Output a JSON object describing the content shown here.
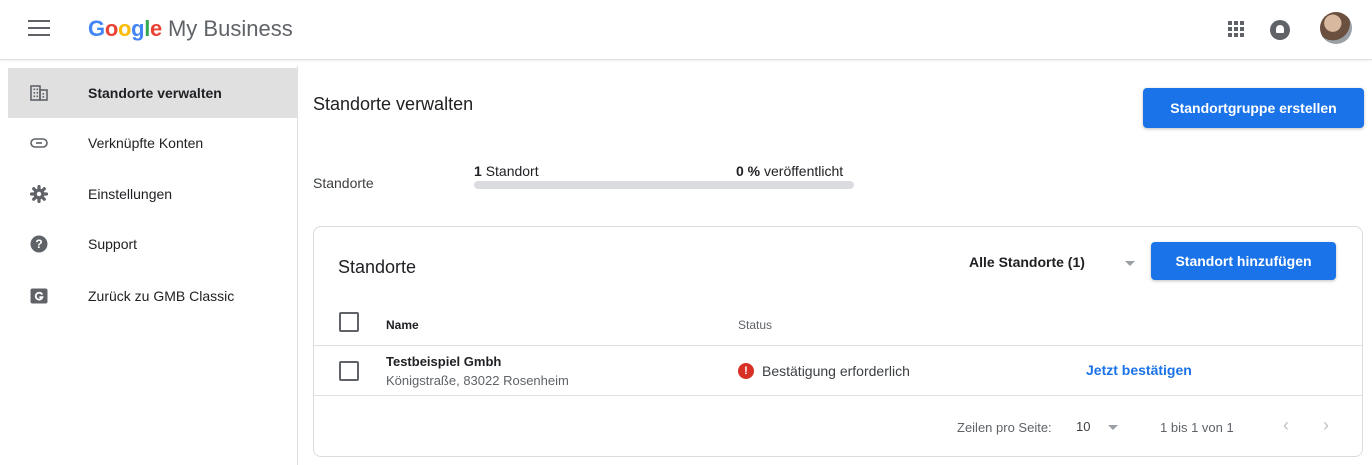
{
  "header": {
    "brand_letters": [
      "G",
      "o",
      "o",
      "g",
      "l",
      "e"
    ],
    "product": "My Business"
  },
  "sidebar": {
    "items": [
      {
        "label": "Standorte verwalten",
        "icon": "building-icon",
        "active": true
      },
      {
        "label": "Verknüpfte Konten",
        "icon": "link-icon"
      },
      {
        "label": "Einstellungen",
        "icon": "gear-icon"
      },
      {
        "label": "Support",
        "icon": "help-icon"
      },
      {
        "label": "Zurück zu GMB Classic",
        "icon": "gmb-classic-icon"
      }
    ]
  },
  "main": {
    "title": "Standorte verwalten",
    "create_group_button": "Standortgruppe erstellen",
    "summary": {
      "label": "Standorte",
      "count_number": "1",
      "count_suffix": "Standort",
      "published_number": "0 %",
      "published_suffix": "veröffentlicht",
      "published_fraction": 0
    }
  },
  "card": {
    "title": "Standorte",
    "filter": "Alle Standorte (1)",
    "add_button": "Standort hinzufügen",
    "columns": {
      "name": "Name",
      "status": "Status"
    },
    "rows": [
      {
        "name": "Testbeispiel Gmbh",
        "address": "Königstraße, 83022 Rosenheim",
        "status": "Bestätigung erforderlich",
        "action": "Jetzt bestätigen"
      }
    ],
    "footer": {
      "rows_per_page_label": "Zeilen pro Seite:",
      "rows_per_page": "10",
      "range": "1 bis 1 von 1"
    }
  },
  "colors": {
    "primary": "#1a73e8",
    "alert": "#d93025"
  }
}
